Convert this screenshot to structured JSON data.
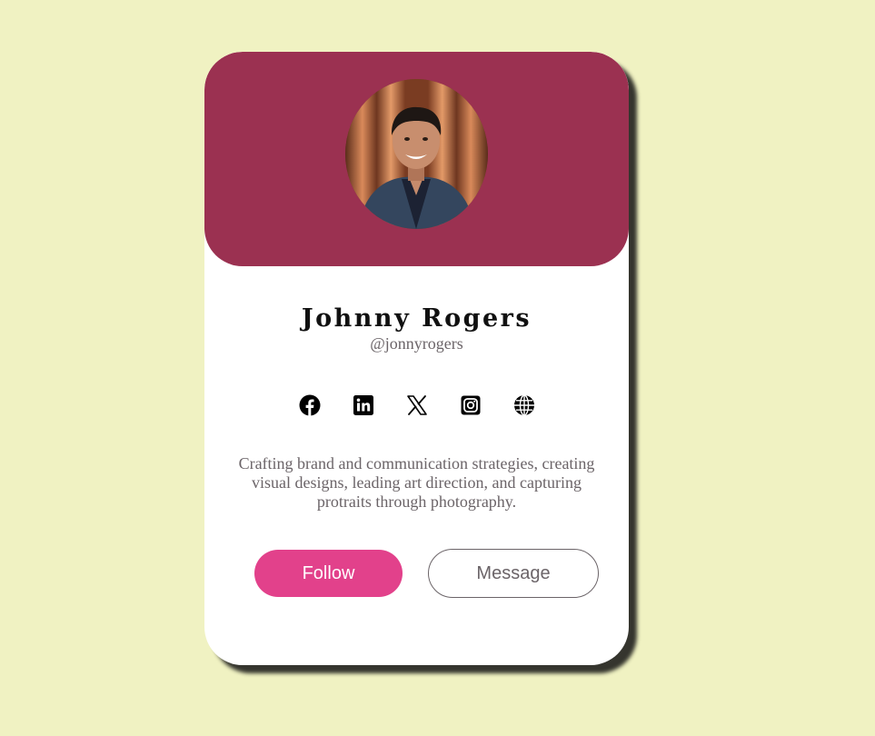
{
  "profile": {
    "name": "Johnny Rogers",
    "handle": "@jonnyrogers",
    "bio": "Crafting brand and communication strategies, creating visual designs, leading art direction, and capturing protraits through photography."
  },
  "socials": [
    {
      "icon": "facebook-icon"
    },
    {
      "icon": "linkedin-icon"
    },
    {
      "icon": "x-twitter-icon"
    },
    {
      "icon": "instagram-icon"
    },
    {
      "icon": "globe-icon"
    }
  ],
  "actions": {
    "follow_label": "Follow",
    "message_label": "Message"
  },
  "colors": {
    "page_background": "#f0f2c2",
    "banner": "#9b3151",
    "follow_button": "#e2418b",
    "muted_text": "#6b6468"
  }
}
